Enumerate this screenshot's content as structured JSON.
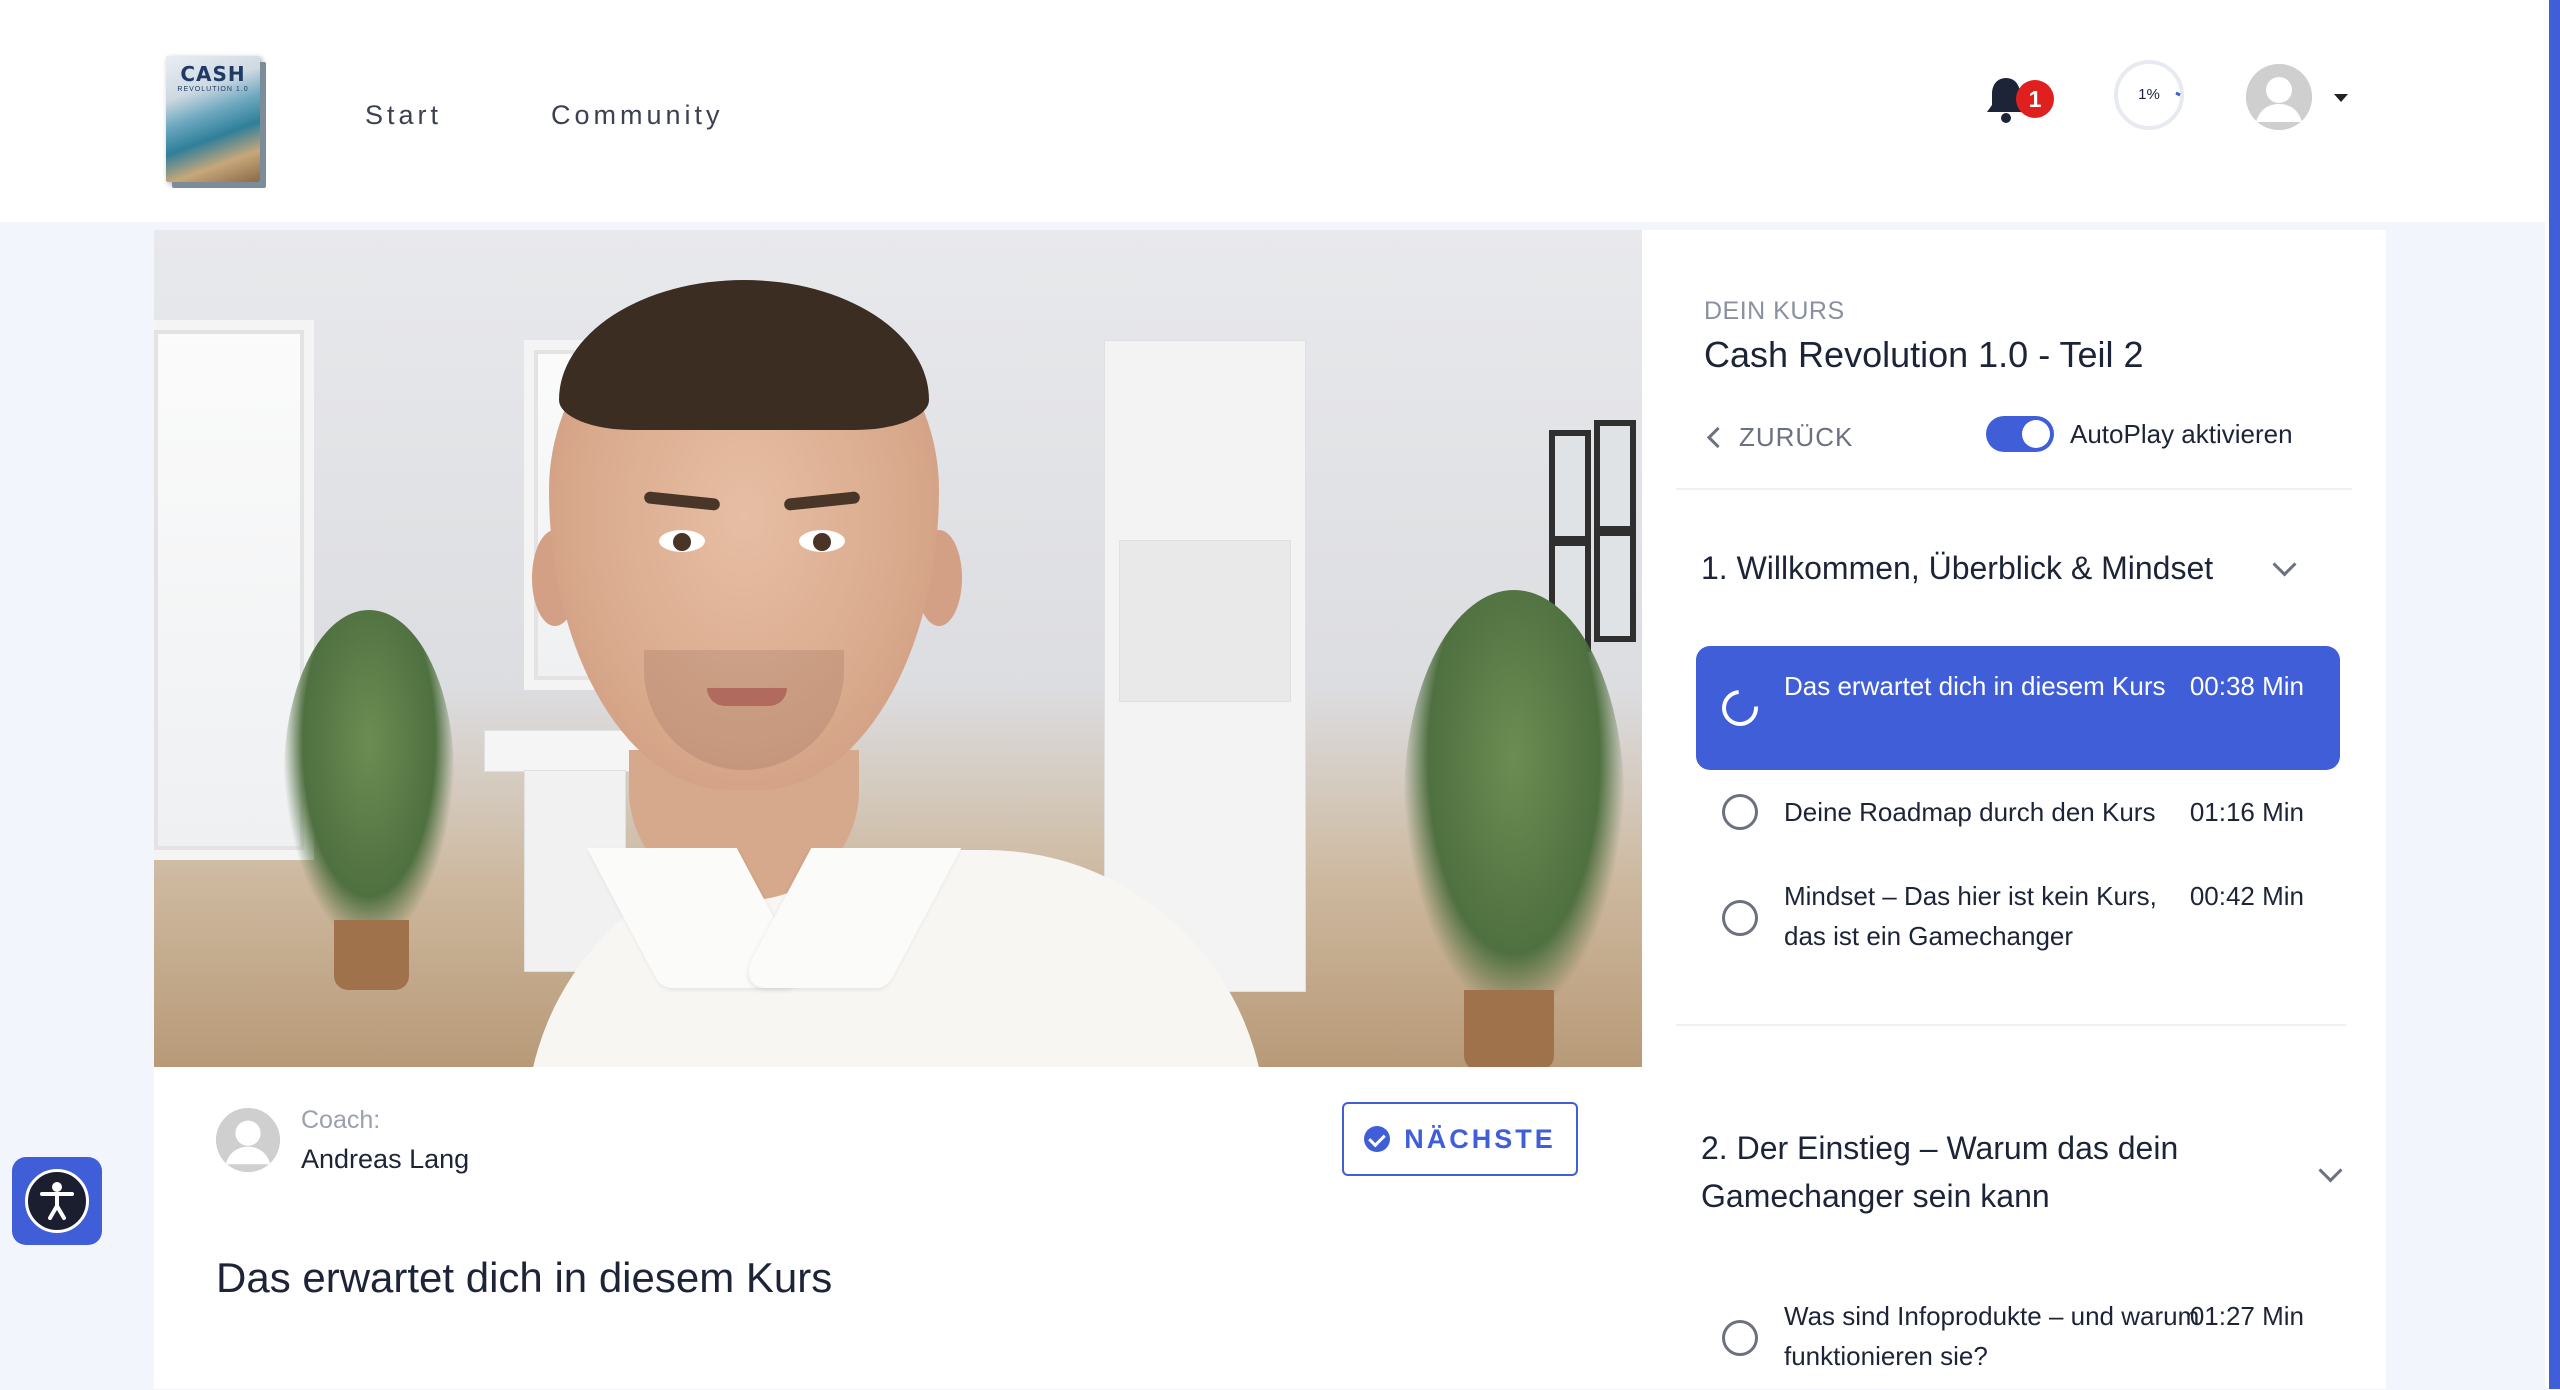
{
  "header": {
    "logo": {
      "title": "CASH",
      "subtitle": "REVOLUTION 1.0"
    },
    "nav": [
      {
        "label": "Start"
      },
      {
        "label": "Community"
      }
    ],
    "notifications_count": "1",
    "progress_percent_label": "1%",
    "progress_percent": 1
  },
  "player": {
    "coach_label": "Coach:",
    "coach_name": "Andreas Lang",
    "next_label": "NÄCHSTE",
    "lesson_title": "Das erwartet dich in diesem Kurs"
  },
  "sidebar": {
    "kicker": "DEIN KURS",
    "course_title": "Cash Revolution 1.0 - Teil 2",
    "back_label": "ZURÜCK",
    "autoplay_label": "AutoPlay aktivieren",
    "autoplay_on": true,
    "sections": [
      {
        "title": "1. Willkommen, Überblick & Mindset",
        "lessons": [
          {
            "name": "Das erwartet dich in diesem Kurs",
            "duration": "00:38 Min",
            "active": true
          },
          {
            "name": "Deine Roadmap durch den Kurs",
            "duration": "01:16 Min",
            "active": false
          },
          {
            "name": "Mindset – Das hier ist kein Kurs, das ist ein Gamechanger",
            "duration": "00:42 Min",
            "active": false
          }
        ]
      },
      {
        "title": "2. Der Einstieg – Warum das dein Gamechanger sein kann",
        "lessons": [
          {
            "name": "Was sind Infoprodukte – und warum funktionieren sie?",
            "duration": "01:27 Min",
            "active": false
          }
        ]
      }
    ]
  },
  "colors": {
    "accent": "#3f5ed8",
    "badge": "#e0201f",
    "text": "#1d2438",
    "muted": "#8a90a0"
  },
  "icons": {
    "bell": "bell-icon",
    "back": "chevron-left-icon",
    "expand": "chevron-down-icon",
    "check": "check-circle-icon",
    "accessibility": "accessibility-icon"
  }
}
